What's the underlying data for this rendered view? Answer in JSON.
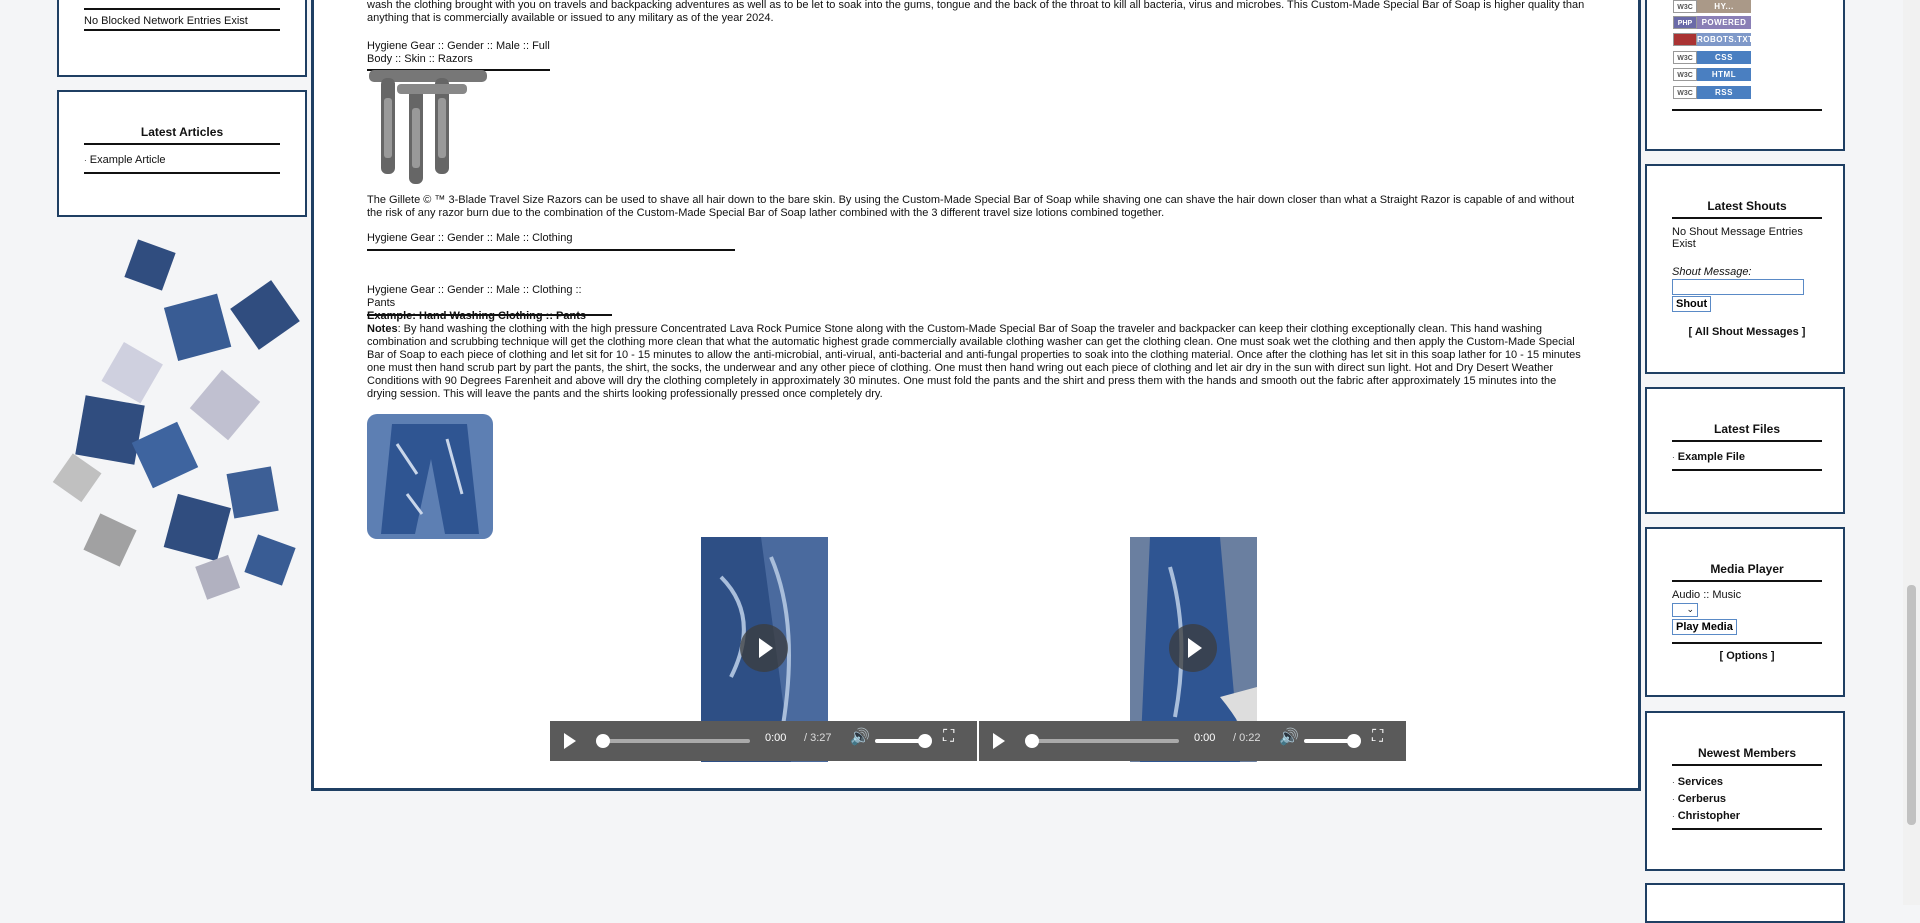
{
  "left": {
    "blocked_text": "No Blocked Network Entries Exist",
    "latest_articles_title": "Latest Articles",
    "articles": [
      "Example Article"
    ]
  },
  "main": {
    "top_text": "wash the clothing brought with you on travels and backpacking adventures as well as to be let to soak into the gums, tongue and the back of the throat to kill all bacteria, virus and microbes. This Custom-Made Special Bar of Soap is higher quality than anything that is commercially available or issued to any military as of the year 2024.",
    "crumb1": "Hygiene Gear :: Gender :: Male :: Full Body :: Skin :: Razors",
    "razor_text": "The Gillete © ™ 3-Blade Travel Size Razors can be used to shave all hair down to the bare skin. By using the Custom-Made Special Bar of Soap while shaving one can shave the hair down closer than what a Straight Razor is capable of and without the risk of any razor burn due to the combination of the Custom-Made Special Bar of Soap lather combined with the 3 different travel size lotions combined together.",
    "crumb2": "Hygiene Gear :: Gender :: Male :: Clothing",
    "crumb3": "Hygiene Gear :: Gender :: Male :: Clothing :: Pants",
    "example_title": "Example: Hand Washing Clothing :: Pants",
    "notes_label": "Notes",
    "notes_text": ": By hand washing the clothing with the high pressure Concentrated Lava Rock Pumice Stone along with the Custom-Made Special Bar of Soap the traveler and backpacker can keep their clothing exceptionally clean. This hand washing combination and scrubbing technique will get the clothing more clean that what the automatic highest grade commercially available clothing washer can get the clothing clean. One must soak wet the clothing and then apply the Custom-Made Special Bar of Soap to each piece of clothing and let sit for 10 - 15 minutes to allow the anti-microbial, anti-virual, anti-bacterial and anti-fungal properties to soak into the clothing material. Once after the clothing has let sit in this soap lather for 10 - 15 minutes one must then hand scrub part by part the pants, the shirt, the socks, the underwear and any other piece of clothing. One must then hand wring out each piece of clothing and let air dry in the sun with direct sun light. Hot and Dry Desert Weather Conditions with 90 Degrees Farenheit and above will dry the clothing completely in approximately 30 minutes. One must fold the pants and the shirt and press them with the hands and smooth out the fabric after approximately 15 minutes into the drying session. This will leave the pants and the shirts looking professionally pressed once completely dry.",
    "video1_time": "0:00",
    "video1_duration": "/ 3:27",
    "video2_time": "0:00",
    "video2_duration": "/ 0:22"
  },
  "right": {
    "badges": [
      {
        "l": "W3C",
        "r": "HY..."
      },
      {
        "l": "PHP",
        "r": "POWERED"
      },
      {
        "l": "",
        "r": "ROBOTS.TXT"
      },
      {
        "l": "W3C",
        "r": "CSS"
      },
      {
        "l": "W3C",
        "r": "HTML"
      },
      {
        "l": "W3C",
        "r": "RSS"
      }
    ],
    "shouts_title": "Latest Shouts",
    "shouts_empty": "No Shout Message Entries Exist",
    "shout_label": "Shout Message:",
    "shout_button": "Shout",
    "all_shouts": "[ All Shout Messages ]",
    "files_title": "Latest Files",
    "files": [
      "Example File"
    ],
    "media_title": "Media Player",
    "media_label": "Audio :: Music",
    "play_media": "Play Media",
    "options": "[ Options ]",
    "members_title": "Newest Members",
    "members": [
      "Services",
      "Cerberus",
      "Christopher"
    ]
  },
  "colors": {
    "panel_border": "#1f3f63",
    "video_controls": "#5a5a5a",
    "badge_blue": "#4a7fc1"
  }
}
